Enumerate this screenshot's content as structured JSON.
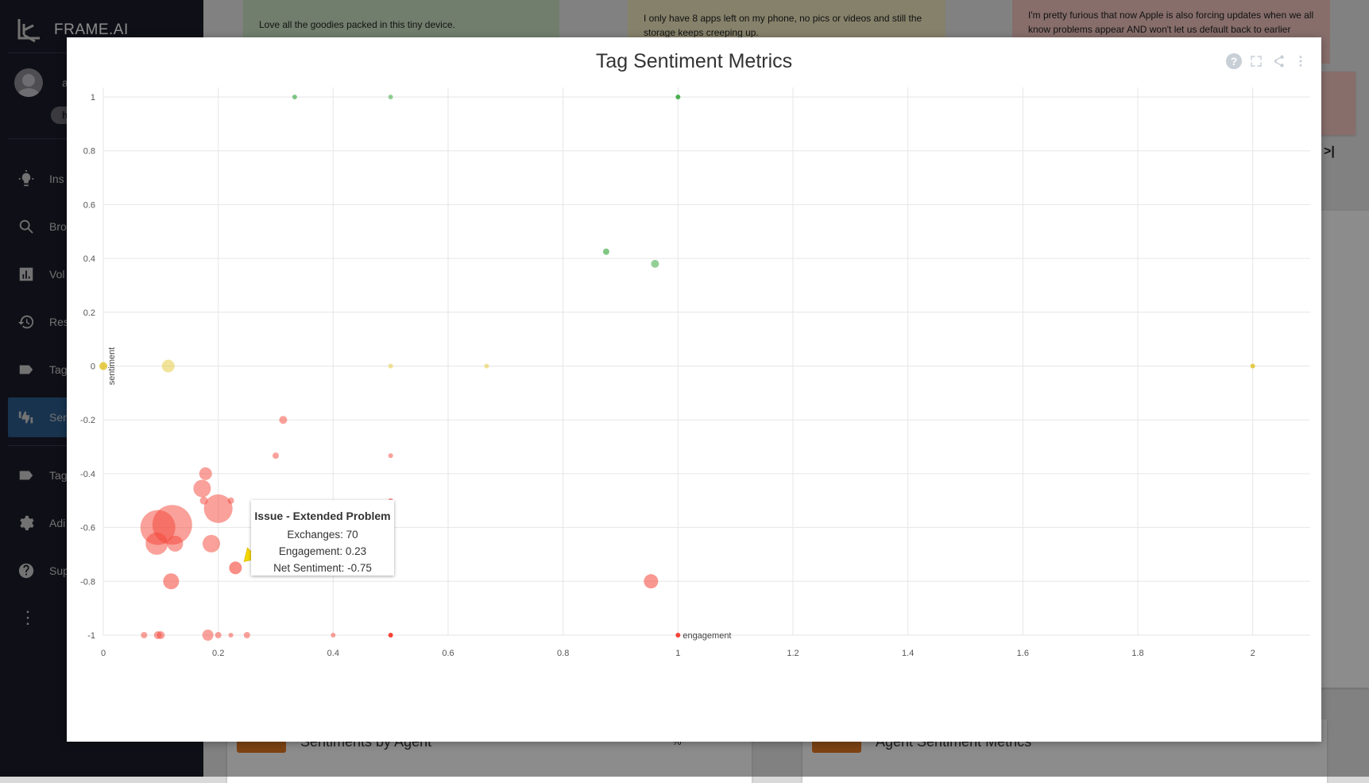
{
  "app": {
    "brand": "FRAME.AI",
    "user_initial": "a",
    "pill_text": "h",
    "nav": [
      {
        "label": "Ins",
        "icon": "lightbulb-icon"
      },
      {
        "label": "Bro",
        "icon": "search-icon"
      },
      {
        "label": "Vol",
        "icon": "bar-chart-icon"
      },
      {
        "label": "Res",
        "icon": "history-icon"
      },
      {
        "label": "Tag",
        "icon": "tag-icon"
      },
      {
        "label": "Sen",
        "icon": "thumbs-icon",
        "active": true
      },
      {
        "label": "Tag",
        "icon": "tag-icon"
      },
      {
        "label": "Adi",
        "icon": "gear-icon"
      },
      {
        "label": "Sup",
        "icon": "help-icon"
      }
    ],
    "reviews": [
      "Love all the goodies packed in this tiny device.",
      "I only have 8 apps left on my phone, no pics or videos and still the storage keeps creeping up.",
      "I'm pretty furious that now Apple is also forcing updates when we all know problems appear AND won't let us default back to earlier"
    ],
    "bottom_cards": [
      "Sentiments by Agent",
      "Agent Sentiment Metrics"
    ],
    "percent_label": "%",
    "last_page_glyph": ">|"
  },
  "modal": {
    "title": "Tag Sentiment Metrics",
    "tools": [
      "help-icon",
      "fullscreen-icon",
      "share-icon",
      "more-icon"
    ]
  },
  "chart_data": {
    "type": "scatter",
    "title": "Tag Sentiment Metrics",
    "xlabel": "engagement",
    "ylabel": "sentiment",
    "xlim": [
      0,
      2.1
    ],
    "ylim": [
      -1,
      1
    ],
    "xticks": [
      0,
      0.2,
      0.4,
      0.6,
      0.8,
      1,
      1.2,
      1.4,
      1.6,
      1.8,
      2
    ],
    "yticks": [
      1,
      0.8,
      0.6,
      0.4,
      0.2,
      0,
      -0.2,
      -0.4,
      -0.6,
      -0.8,
      -1
    ],
    "grid": true,
    "colors": {
      "positive": "#4caf50",
      "neutral": "#e0c020",
      "negative": "#f44336"
    },
    "points": [
      {
        "x": 0.333,
        "y": 1,
        "r": 3,
        "c": "positive",
        "a": 0.7
      },
      {
        "x": 0.5,
        "y": 1,
        "r": 3,
        "c": "positive",
        "a": 0.6
      },
      {
        "x": 1.0,
        "y": 1,
        "r": 3,
        "c": "positive",
        "a": 1
      },
      {
        "x": 0.875,
        "y": 0.425,
        "r": 4,
        "c": "positive",
        "a": 0.7
      },
      {
        "x": 0.96,
        "y": 0.38,
        "r": 5,
        "c": "positive",
        "a": 0.6
      },
      {
        "x": 0.0,
        "y": 0,
        "r": 5,
        "c": "neutral",
        "a": 0.8
      },
      {
        "x": 0.113,
        "y": 0,
        "r": 8,
        "c": "neutral",
        "a": 0.45
      },
      {
        "x": 0.5,
        "y": 0,
        "r": 3,
        "c": "neutral",
        "a": 0.45
      },
      {
        "x": 0.667,
        "y": 0,
        "r": 3,
        "c": "neutral",
        "a": 0.45
      },
      {
        "x": 2.0,
        "y": 0,
        "r": 3,
        "c": "neutral",
        "a": 0.8
      },
      {
        "x": 0.313,
        "y": -0.2,
        "r": 5,
        "c": "negative",
        "a": 0.5
      },
      {
        "x": 0.3,
        "y": -0.333,
        "r": 4,
        "c": "negative",
        "a": 0.5
      },
      {
        "x": 0.5,
        "y": -0.333,
        "r": 3,
        "c": "negative",
        "a": 0.5
      },
      {
        "x": 0.178,
        "y": -0.4,
        "r": 8,
        "c": "negative",
        "a": 0.5
      },
      {
        "x": 0.172,
        "y": -0.455,
        "r": 11,
        "c": "negative",
        "a": 0.5
      },
      {
        "x": 0.175,
        "y": -0.5,
        "r": 5,
        "c": "negative",
        "a": 0.5
      },
      {
        "x": 0.222,
        "y": -0.5,
        "r": 4,
        "c": "negative",
        "a": 0.5
      },
      {
        "x": 0.5,
        "y": -0.5,
        "r": 3,
        "c": "negative",
        "a": 0.5
      },
      {
        "x": 0.2,
        "y": -0.53,
        "r": 18,
        "c": "negative",
        "a": 0.5
      },
      {
        "x": 0.12,
        "y": -0.59,
        "r": 25,
        "c": "negative",
        "a": 0.5
      },
      {
        "x": 0.095,
        "y": -0.6,
        "r": 22,
        "c": "negative",
        "a": 0.5
      },
      {
        "x": 0.093,
        "y": -0.66,
        "r": 14,
        "c": "negative",
        "a": 0.5
      },
      {
        "x": 0.125,
        "y": -0.66,
        "r": 10,
        "c": "negative",
        "a": 0.5
      },
      {
        "x": 0.188,
        "y": -0.66,
        "r": 11,
        "c": "negative",
        "a": 0.5
      },
      {
        "x": 0.23,
        "y": -0.75,
        "r": 8,
        "c": "negative",
        "a": 0.6
      },
      {
        "x": 0.118,
        "y": -0.8,
        "r": 10,
        "c": "negative",
        "a": 0.55
      },
      {
        "x": 0.953,
        "y": -0.8,
        "r": 9,
        "c": "negative",
        "a": 0.55
      },
      {
        "x": 0.071,
        "y": -1,
        "r": 4,
        "c": "negative",
        "a": 0.5
      },
      {
        "x": 0.095,
        "y": -1,
        "r": 5,
        "c": "negative",
        "a": 0.5
      },
      {
        "x": 0.1,
        "y": -1,
        "r": 5,
        "c": "negative",
        "a": 0.5
      },
      {
        "x": 0.182,
        "y": -1,
        "r": 7,
        "c": "negative",
        "a": 0.5
      },
      {
        "x": 0.2,
        "y": -1,
        "r": 4,
        "c": "negative",
        "a": 0.5
      },
      {
        "x": 0.222,
        "y": -1,
        "r": 3,
        "c": "negative",
        "a": 0.5
      },
      {
        "x": 0.25,
        "y": -1,
        "r": 4,
        "c": "negative",
        "a": 0.5
      },
      {
        "x": 0.4,
        "y": -1,
        "r": 3,
        "c": "negative",
        "a": 0.5
      },
      {
        "x": 0.5,
        "y": -1,
        "r": 3,
        "c": "negative",
        "a": 1
      },
      {
        "x": 1.0,
        "y": -1,
        "r": 3,
        "c": "negative",
        "a": 1
      }
    ],
    "tooltip": {
      "title": "Issue - Extended Problem",
      "exchanges": "Exchanges: 70",
      "engagement": "Engagement: 0.23",
      "sentiment": "Net Sentiment: -0.75",
      "point_index": 24
    }
  }
}
